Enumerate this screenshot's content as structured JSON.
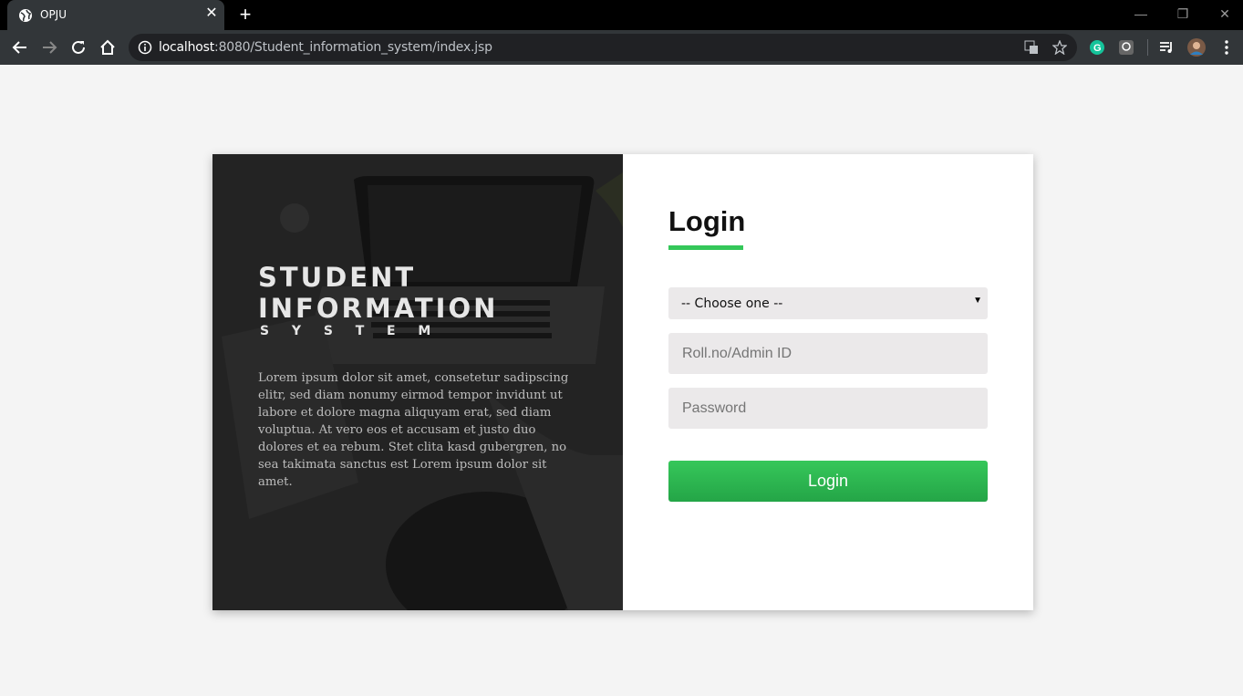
{
  "browser": {
    "tab_title": "OPJU",
    "url_host": "localhost",
    "url_rest": ":8080/Student_information_system/index.jsp"
  },
  "hero": {
    "title_line1": "STUDENT",
    "title_line2": "INFORMATION",
    "subtitle": "SYSTEM",
    "body": "Lorem ipsum dolor sit amet, consetetur sadipscing elitr, sed diam nonumy eirmod tempor invidunt ut labore et dolore magna aliquyam erat, sed diam voluptua. At vero eos et accusam et justo duo dolores et ea rebum. Stet clita kasd gubergren, no sea takimata sanctus est Lorem ipsum dolor sit amet."
  },
  "login": {
    "title": "Login",
    "role_select": "-- Choose one --",
    "id_placeholder": "Roll.no/Admin ID",
    "password_placeholder": "Password",
    "button_label": "Login",
    "accent_color": "#34c759"
  }
}
